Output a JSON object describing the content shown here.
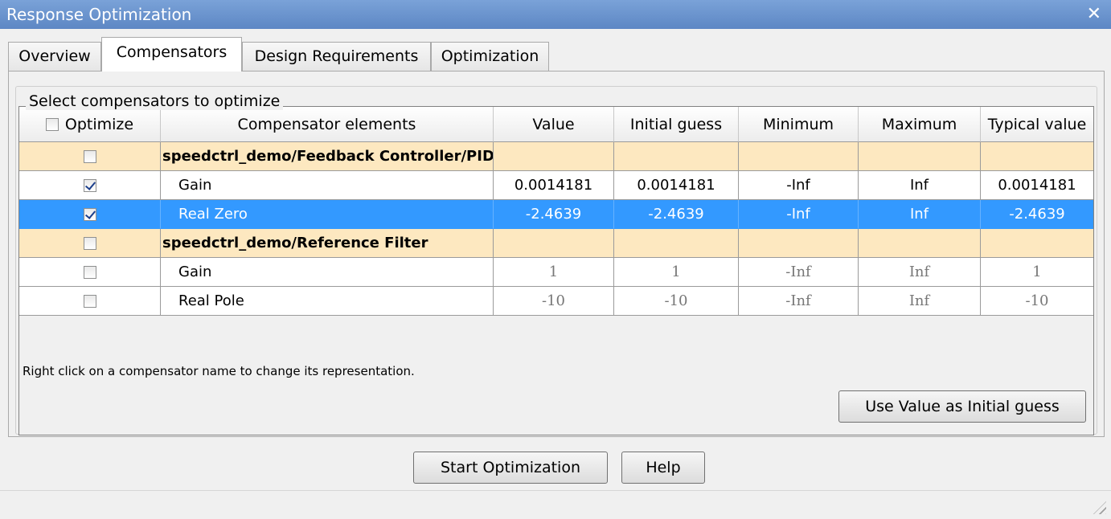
{
  "window": {
    "title": "Response Optimization",
    "close_glyph": "✕"
  },
  "tabs": [
    {
      "label": "Overview",
      "active": false
    },
    {
      "label": "Compensators",
      "active": true
    },
    {
      "label": "Design Requirements",
      "active": false
    },
    {
      "label": "Optimization",
      "active": false
    }
  ],
  "group_label": "Select compensators to optimize",
  "table": {
    "headers": [
      "Optimize",
      "Compensator elements",
      "Value",
      "Initial guess",
      "Minimum",
      "Maximum",
      "Typical value"
    ],
    "header_checked": false,
    "rows": [
      {
        "type": "group",
        "checked": false,
        "name": "speedctrl_demo/Feedback Controller/PID Controller"
      },
      {
        "type": "item",
        "checked": true,
        "selected": false,
        "name": "Gain",
        "value": "0.0014181",
        "initial": "0.0014181",
        "min": "-Inf",
        "max": "Inf",
        "typical": "0.0014181"
      },
      {
        "type": "item",
        "checked": true,
        "selected": true,
        "name": "Real Zero",
        "value": "-2.4639",
        "initial": "-2.4639",
        "min": "-Inf",
        "max": "Inf",
        "typical": "-2.4639"
      },
      {
        "type": "group",
        "checked": false,
        "name": "speedctrl_demo/Reference Filter"
      },
      {
        "type": "item",
        "checked": false,
        "selected": false,
        "name": "Gain",
        "value": "1",
        "initial": "1",
        "min": "-Inf",
        "max": "Inf",
        "typical": "1"
      },
      {
        "type": "item",
        "checked": false,
        "selected": false,
        "name": "Real Pole",
        "value": "-10",
        "initial": "-10",
        "min": "-Inf",
        "max": "Inf",
        "typical": "-10"
      }
    ]
  },
  "hint": "Right click on a compensator name to change its representation.",
  "buttons": {
    "use_value": "Use Value as Initial guess",
    "start": "Start Optimization",
    "help": "Help"
  },
  "colors": {
    "selection": "#3399ff",
    "group_row": "#fde8c0",
    "titlebar": "#6b93cd"
  }
}
